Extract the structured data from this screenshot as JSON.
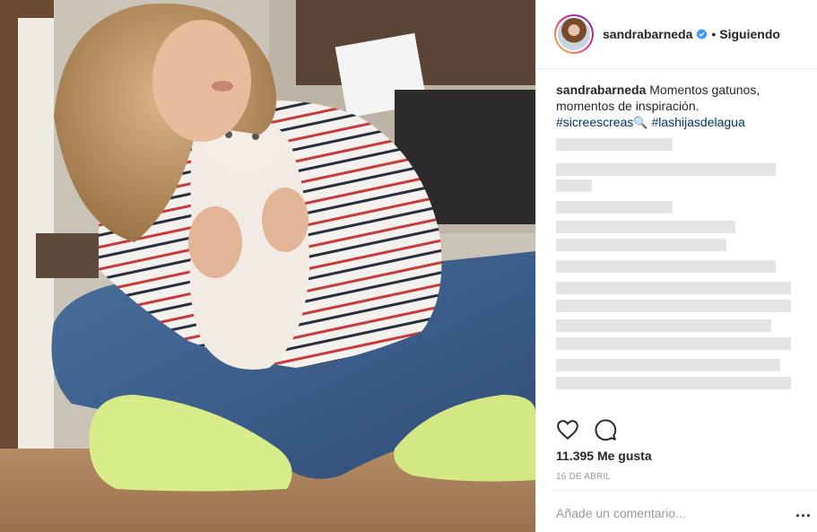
{
  "post": {
    "username": "sandrabarneda",
    "separator": "•",
    "follow_status": "Siguiendo",
    "caption_user": "sandrabarneda",
    "caption_text": " Momentos gatunos, momentos de inspiración.",
    "hashtag_1": "#sicreescreas",
    "hashtag_2": "#lashijasdelagua",
    "likes": "11.395 Me gusta",
    "date": "16 DE ABRIL",
    "comment_placeholder": "Añade un comentario...",
    "more_options": "..."
  },
  "icons": {
    "verified": "verified-badge-icon",
    "magnifier": "magnifying-glass-emoji-icon",
    "like": "heart-icon",
    "comment": "comment-bubble-icon",
    "more": "ellipsis-icon"
  },
  "colors": {
    "verified_blue": "#3897f0",
    "hashtag": "#003569",
    "muted": "#999999"
  }
}
